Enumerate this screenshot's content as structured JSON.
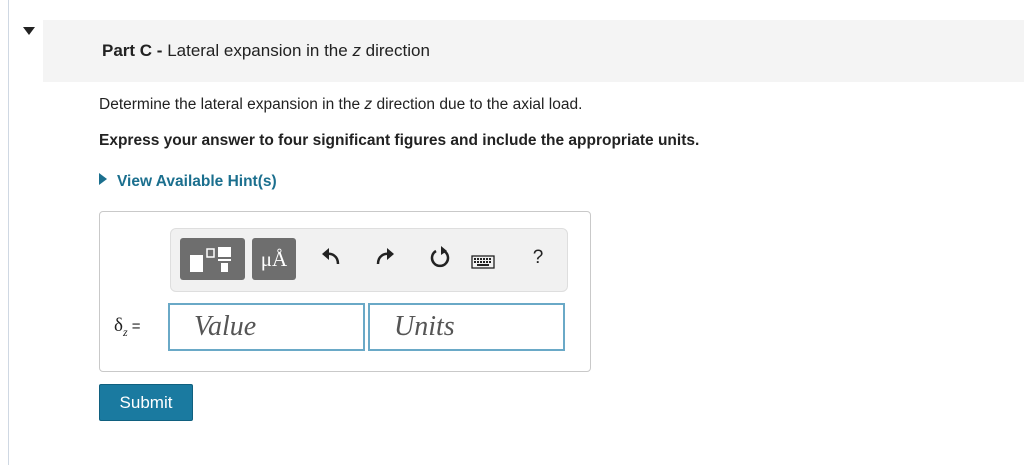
{
  "part": {
    "label": "Part C",
    "separator": " - ",
    "title_before": "Lateral expansion in the ",
    "title_var": "z",
    "title_after": " direction"
  },
  "question": {
    "before": "Determine the lateral expansion in the ",
    "var": "z",
    "after": " direction due to the axial load."
  },
  "instructions": "Express your answer to four significant figures and include the appropriate units.",
  "hint_link": "View Available Hint(s)",
  "toolbar": {
    "templates_icon": "templates-icon",
    "units_label": "μÅ",
    "undo_icon": "undo-icon",
    "redo_icon": "redo-icon",
    "reset_icon": "reset-icon",
    "keyboard_icon": "keyboard-icon",
    "help_label": "?"
  },
  "answer": {
    "symbol": "δ",
    "subscript": "z",
    "equals": " =",
    "value_placeholder": "Value",
    "units_placeholder": "Units"
  },
  "submit_label": "Submit",
  "colors": {
    "link": "#1b6f8e",
    "submit_bg": "#1a7aa0",
    "field_border": "#6aa9c7",
    "toolbar_button": "#6e6e6e"
  }
}
